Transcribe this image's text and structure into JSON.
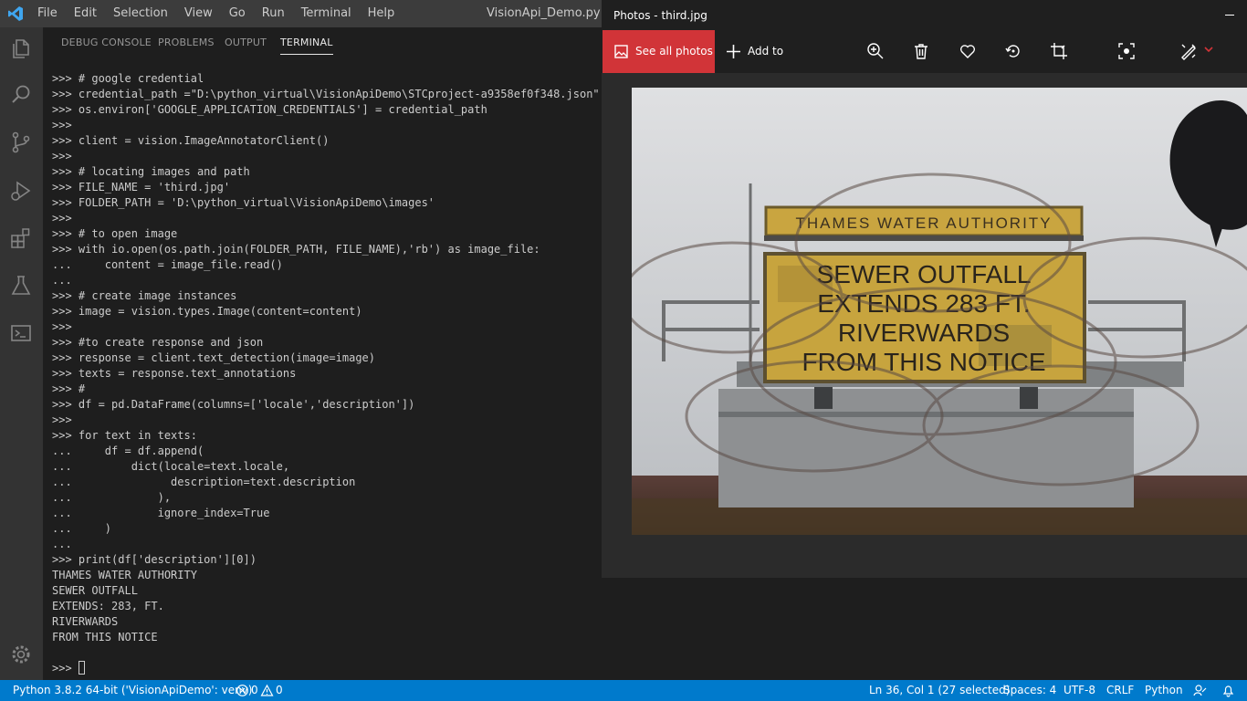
{
  "vscode": {
    "menu": [
      "File",
      "Edit",
      "Selection",
      "View",
      "Go",
      "Run",
      "Terminal",
      "Help"
    ],
    "window_title": "VisionApi_Demo.py - py",
    "panel_tabs": [
      "DEBUG CONSOLE",
      "PROBLEMS",
      "OUTPUT",
      "TERMINAL"
    ],
    "active_tab": "TERMINAL",
    "activity_icons": [
      "explorer-icon",
      "search-icon",
      "source-control-icon",
      "run-debug-icon",
      "extensions-icon",
      "testing-icon",
      "remote-icon",
      "settings-gear-icon"
    ],
    "terminal_lines": [
      ">>> # google credential",
      ">>> credential_path =\"D:\\python_virtual\\VisionApiDemo\\STCproject-a9358ef0f348.json\"",
      ">>> os.environ['GOOGLE_APPLICATION_CREDENTIALS'] = credential_path",
      ">>>",
      ">>> client = vision.ImageAnnotatorClient()",
      ">>>",
      ">>> # locating images and path",
      ">>> FILE_NAME = 'third.jpg'",
      ">>> FOLDER_PATH = 'D:\\python_virtual\\VisionApiDemo\\images'",
      ">>>",
      ">>> # to open image",
      ">>> with io.open(os.path.join(FOLDER_PATH, FILE_NAME),'rb') as image_file:",
      "...     content = image_file.read()",
      "...",
      ">>> # create image instances",
      ">>> image = vision.types.Image(content=content)",
      ">>>",
      ">>> #to create response and json",
      ">>> response = client.text_detection(image=image)",
      ">>> texts = response.text_annotations",
      ">>> #",
      ">>> df = pd.DataFrame(columns=['locale','description'])",
      ">>>",
      ">>> for text in texts:",
      "...     df = df.append(",
      "...         dict(locale=text.locale,",
      "...               description=text.description",
      "...             ),",
      "...             ignore_index=True",
      "...     )",
      "...",
      ">>> print(df['description'][0])",
      "THAMES WATER AUTHORITY",
      "SEWER OUTFALL",
      "EXTENDS: 283, FT.",
      "RIVERWARDS",
      "FROM THIS NOTICE",
      ""
    ],
    "prompt": ">>> ",
    "status": {
      "interpreter": "Python 3.8.2 64-bit ('VisionApiDemo': venv)",
      "errors": "0",
      "warnings": "0",
      "position": "Ln 36, Col 1 (27 selected)",
      "spaces": "Spaces: 4",
      "encoding": "UTF-8",
      "eol": "CRLF",
      "language": "Python"
    }
  },
  "photos": {
    "title": "Photos - third.jpg",
    "see_all": "See all photos",
    "add_to": "Add to",
    "toolbar_icons": [
      "zoom-icon",
      "delete-icon",
      "favorite-icon",
      "rotate-icon",
      "crop-icon",
      "enhance-icon",
      "edit-icon"
    ],
    "accent": "#d13438",
    "image_sign": {
      "header": "THAMES WATER AUTHORITY",
      "lines": [
        "SEWER OUTFALL",
        "EXTENDS 283 FT.",
        "RIVERWARDS",
        "FROM THIS NOTICE"
      ]
    }
  },
  "colors": {
    "statusbar": "#007acc",
    "titlebar": "#3c3c3c",
    "activitybar": "#333333",
    "editor_bg": "#1e1e1e"
  }
}
